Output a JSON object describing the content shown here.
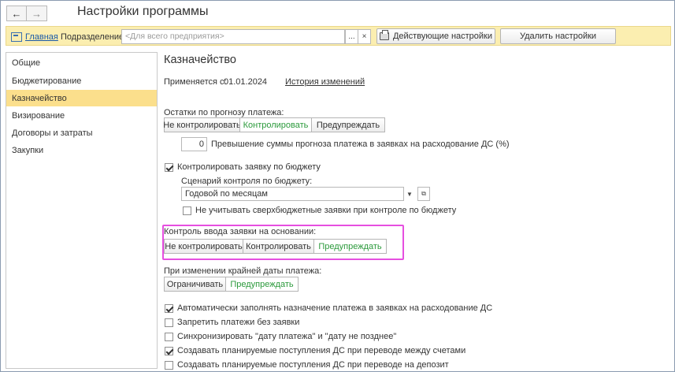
{
  "window": {
    "title": "Настройки программы",
    "back_icon": "←",
    "forward_icon": "→"
  },
  "toolbar": {
    "home_label": "Главная",
    "division_label": "Подразделение:",
    "division_placeholder": "<Для всего предприятия>",
    "select_button": "...",
    "clear_button": "×",
    "current_settings_label": "Действующие настройки",
    "delete_settings_label": "Удалить настройки"
  },
  "sidebar": {
    "items": [
      {
        "label": "Общие"
      },
      {
        "label": "Бюджетирование"
      },
      {
        "label": "Казначейство"
      },
      {
        "label": "Визирование"
      },
      {
        "label": "Договоры и затраты"
      },
      {
        "label": "Закупки"
      }
    ],
    "active_index": 2
  },
  "main": {
    "title": "Казначейство",
    "applies_from_label": "Применяется с:",
    "applies_from_date": "01.01.2024",
    "history_link": "История изменений",
    "forecast": {
      "label": "Остатки по прогнозу платежа:",
      "options": [
        "Не контролировать",
        "Контролировать",
        "Предупреждать"
      ],
      "selected": "Контролировать",
      "excess_value": "0",
      "excess_label": "Превышение суммы прогноза платежа в заявках на расходование ДС (%)"
    },
    "budget": {
      "checkbox_label": "Контролировать заявку по бюджету",
      "checked": true,
      "scenario_label": "Сценарий контроля по бюджету:",
      "scenario_value": "Годовой по месяцам",
      "ignore_label": "Не учитывать сверхбюджетные заявки при контроле по бюджету",
      "ignore_checked": false
    },
    "basis": {
      "label": "Контроль ввода заявки на основании:",
      "options": [
        "Не контролировать",
        "Контролировать",
        "Предупреждать"
      ],
      "selected": "Предупреждать"
    },
    "deadline": {
      "label": "При изменении крайней даты платежа:",
      "options": [
        "Ограничивать",
        "Предупреждать"
      ],
      "selected": "Предупреждать"
    },
    "checkboxes": [
      {
        "label": "Автоматически заполнять назначение платежа в заявках на расходование ДС",
        "checked": true
      },
      {
        "label": "Запретить платежи без заявки",
        "checked": false
      },
      {
        "label": "Синхронизировать \"дату платежа\" и \"дату не позднее\"",
        "checked": false
      },
      {
        "label": "Создавать планируемые поступления ДС при переводе между счетами",
        "checked": true
      },
      {
        "label": "Создавать планируемые поступления ДС при переводе на депозит",
        "checked": false
      }
    ]
  },
  "colors": {
    "toolbar_bg": "#fbeeb0",
    "sidebar_active": "#fbdf8c",
    "selected_text": "#2c9a3c",
    "highlight_border": "#e64fe0",
    "link": "#1a5aa8"
  }
}
